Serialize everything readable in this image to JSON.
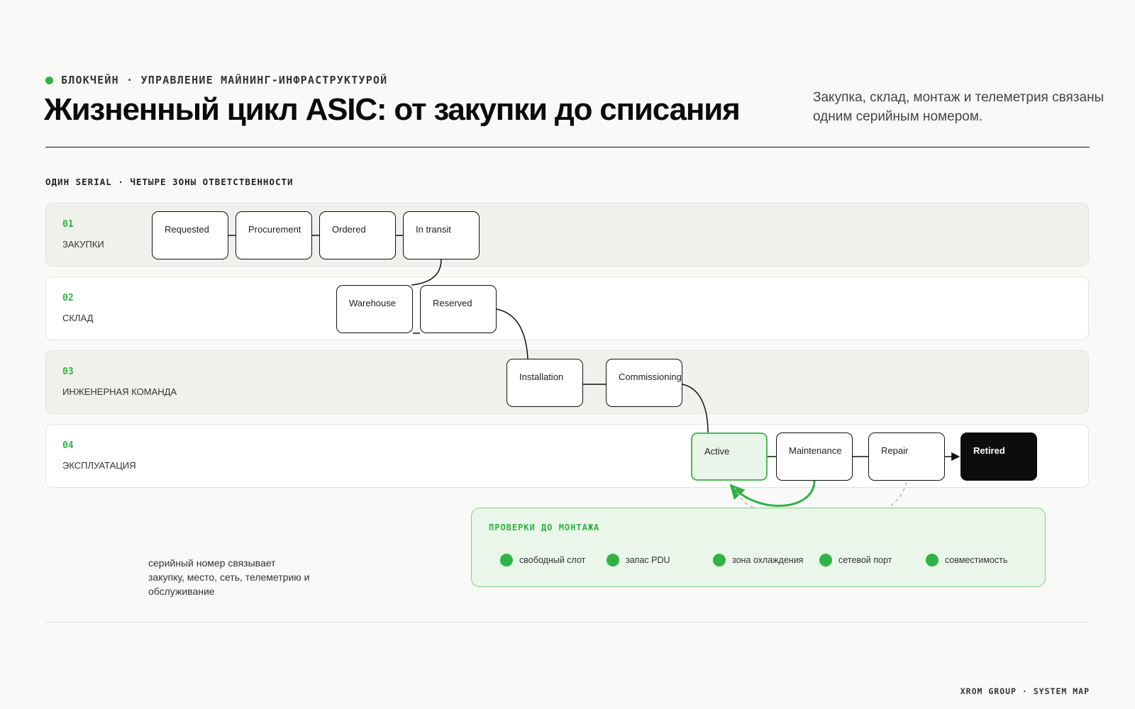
{
  "header": {
    "eyebrow": "БЛОКЧЕЙН · УПРАВЛЕНИЕ МАЙНИНГ-ИНФРАСТРУКТУРОЙ",
    "title": "Жизненный цикл ASIC: от закупки до списания",
    "subtitle": "Закупка, склад, монтаж и телеметрия связаны одним серийным номером."
  },
  "section_label": "ОДИН SERIAL · ЧЕТЫРЕ ЗОНЫ ОТВЕТСТВЕННОСТИ",
  "lanes": [
    {
      "num": "01",
      "name": "ЗАКУПКИ"
    },
    {
      "num": "02",
      "name": "СКЛАД"
    },
    {
      "num": "03",
      "name": "ИНЖЕНЕРНАЯ КОМАНДА"
    },
    {
      "num": "04",
      "name": "ЭКСПЛУАТАЦИЯ"
    }
  ],
  "nodes": {
    "requested": "Requested",
    "procurement": "Procurement",
    "ordered": "Ordered",
    "in_transit": "In transit",
    "warehouse": "Warehouse",
    "reserved": "Reserved",
    "installation": "Installation",
    "commissioning": "Commissioning",
    "active": "Active",
    "maintenance": "Maintenance",
    "repair": "Repair",
    "retired": "Retired"
  },
  "checks": {
    "title": "ПРОВЕРКИ ДО МОНТАЖА",
    "items": [
      "свободный слот",
      "запас PDU",
      "зона охлаждения",
      "сетевой порт",
      "совместимость"
    ]
  },
  "note": "серийный номер связывает закупку, место, сеть, телеметрию и обслуживание",
  "footer": "XROM GROUP · SYSTEM MAP",
  "colors": {
    "accent": "#2fb344",
    "active_fill": "#e8f5e8",
    "retired_fill": "#0d0d0d"
  }
}
